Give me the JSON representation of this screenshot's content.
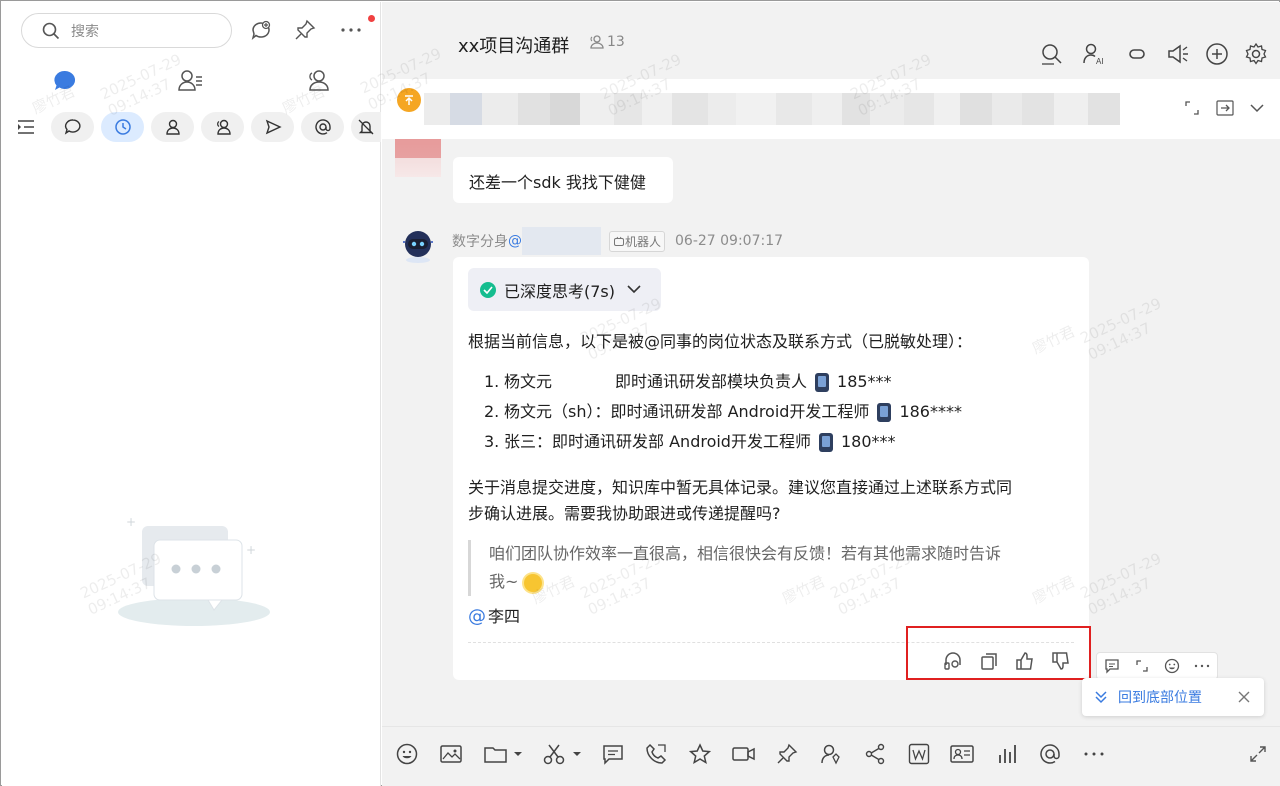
{
  "left_panel": {
    "search_placeholder": "搜索",
    "icons": {
      "search": "search-icon",
      "new_topic": "chat-plus-icon",
      "pin": "pin-icon",
      "more": "more-icon"
    },
    "tabs": [
      "chat-bubble-icon",
      "contacts-list-icon",
      "group-icon"
    ],
    "filters": [
      "menu-toggle-icon",
      "chat-icon",
      "clock-icon",
      "user-icon",
      "group-users-icon",
      "send-icon",
      "at-icon",
      "mute-bell-icon"
    ],
    "active_filter_index": 2,
    "accent_color": "#3a7be0"
  },
  "chat": {
    "title": "xx项目沟通群",
    "member_count": "13",
    "header_icons": [
      "search-history-icon",
      "ai-user-icon",
      "link-icon",
      "announce-icon",
      "add-icon",
      "settings-icon"
    ],
    "message1_text": "还差一个sdk 我找下健健",
    "bot": {
      "sender_prefix": "数字分身",
      "at_symbol": "@",
      "badge": "机器人",
      "time": "06-27 09:07:17",
      "thinking_label": "已深度思考(7s)",
      "intro": "根据当前信息，以下是被@同事的岗位状态及联系方式（已脱敏处理）：",
      "contacts": [
        {
          "num": "1.",
          "name": "杨文元",
          "dept": "即时通讯研发部模块负责人",
          "phone": "185***"
        },
        {
          "num": "2.",
          "name": "杨文元（sh）：",
          "dept": "即时通讯研发部 Android开发工程师",
          "phone": "186****"
        },
        {
          "num": "3.",
          "name": "张三：",
          "dept": "即时通讯研发部 Android开发工程师",
          "phone": "180***"
        }
      ],
      "summary_line1": "关于消息提交进度，知识库中暂无具体记录。建议您直接通过上述联系方式同",
      "summary_line2": "步确认进展。需要我协助跟进或传递提醒吗?",
      "quote_line1": "咱们团队协作效率一直很高，相信很快会有反馈！若有其他需求随时告诉",
      "quote_line2": "我~",
      "mention_at": "@",
      "mention_name": "李四"
    },
    "message_actions": [
      "reread-icon",
      "copy-icon",
      "thumbs-up-icon",
      "thumbs-down-icon"
    ],
    "hover_actions": [
      "comment-icon",
      "quote-icon",
      "emoji-icon",
      "more-icon"
    ],
    "toast_text": "回到底部位置",
    "toolbar_icons": [
      "emoji-icon",
      "screenshot-icon",
      "folder-icon",
      "scissors-icon",
      "message-icon",
      "phone-icon",
      "star-icon",
      "video-icon",
      "pin-icon",
      "contact-ai-icon",
      "share-icon",
      "doc-w-icon",
      "card-icon",
      "stats-icon",
      "at-icon",
      "more-icon",
      "expand-icon"
    ],
    "watermark": [
      "廖竹君",
      "2025-07-29",
      "09:14:37"
    ]
  }
}
